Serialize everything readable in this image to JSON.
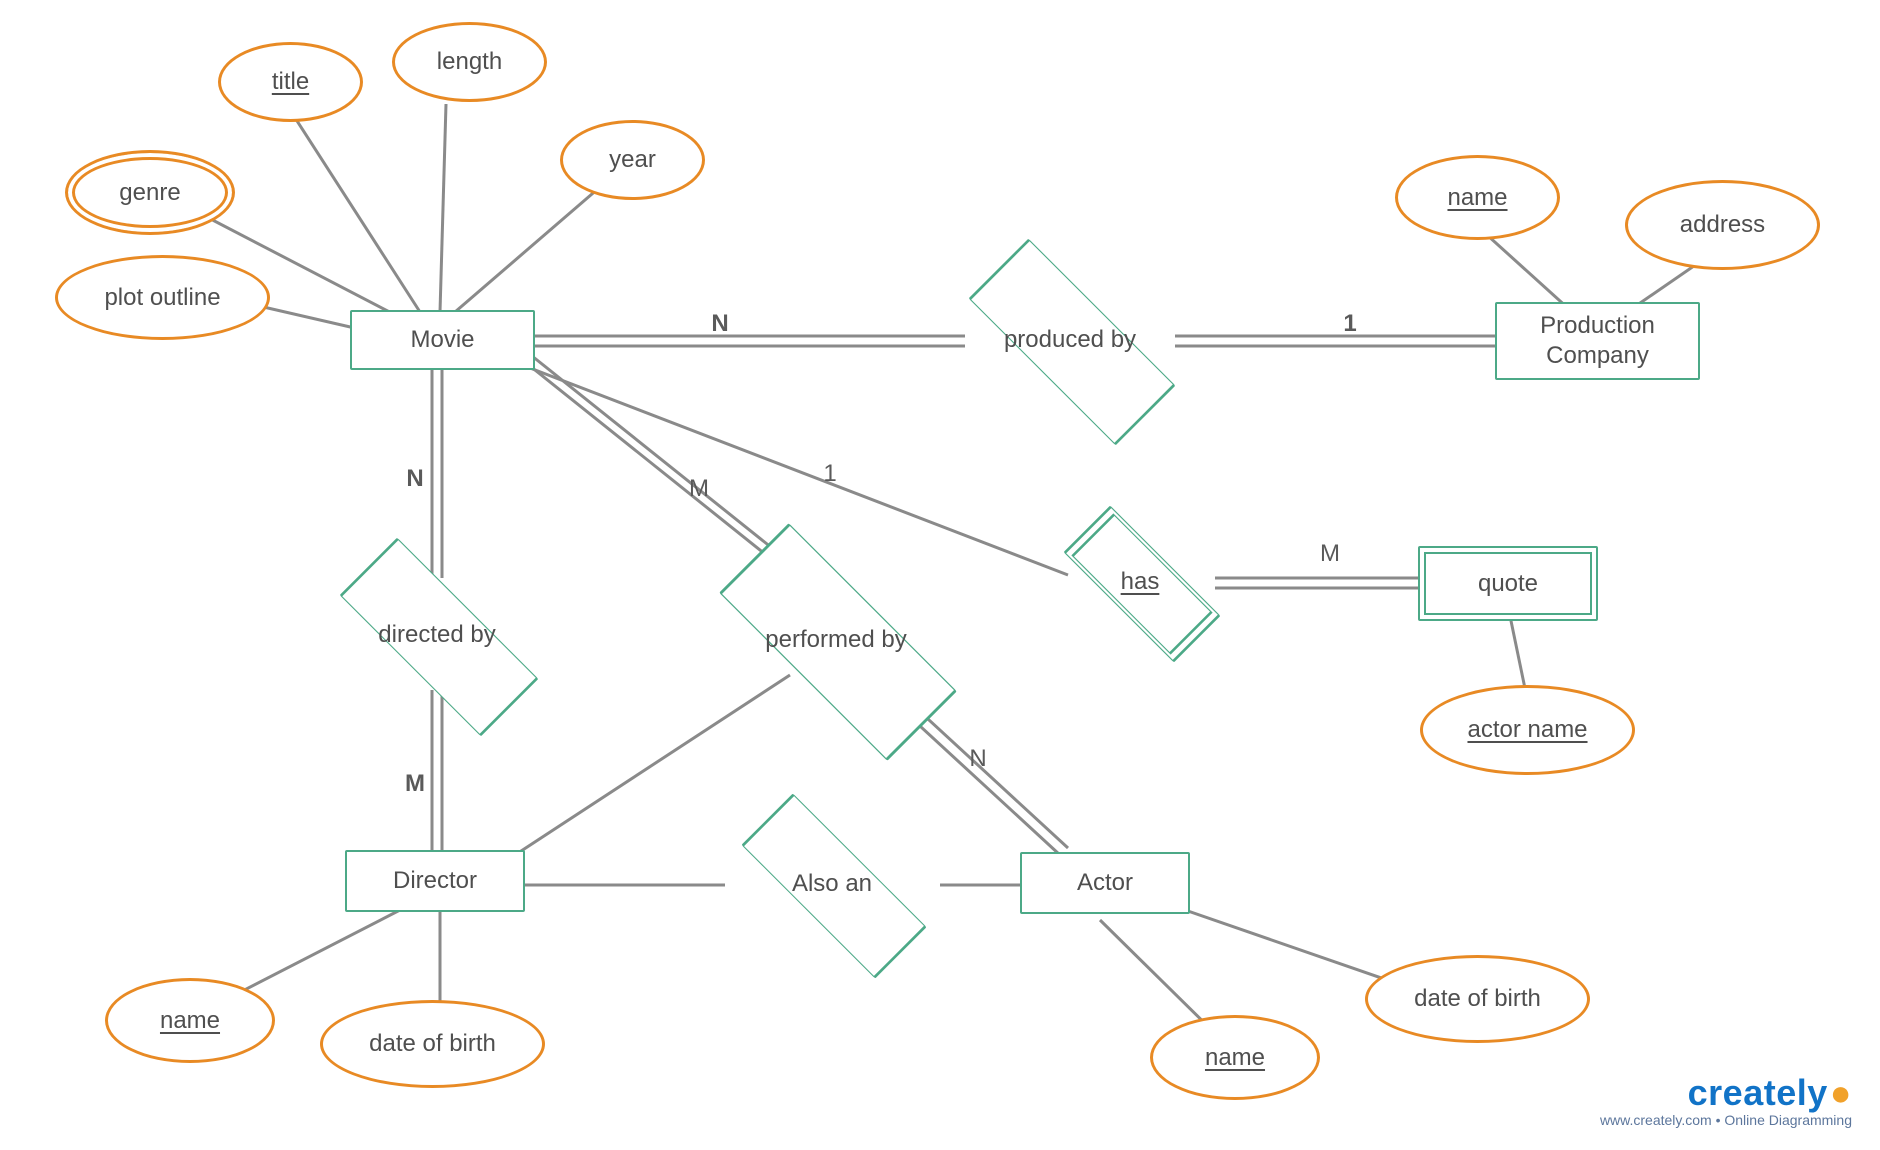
{
  "entities": {
    "movie": "Movie",
    "production_company": "Production\nCompany",
    "director": "Director",
    "actor": "Actor",
    "quote": "quote"
  },
  "relationships": {
    "produced_by": "produced by",
    "directed_by": "directed by",
    "performed_by": "performed by",
    "has": "has",
    "also_an": "Also an"
  },
  "attributes": {
    "genre": "genre",
    "title": "title",
    "length": "length",
    "year": "year",
    "plot_outline": "plot outline",
    "pc_name": "name",
    "pc_address": "address",
    "director_name": "name",
    "director_dob": "date of birth",
    "actor_name_attr": "name",
    "actor_dob": "date of birth",
    "quote_actor_name": "actor name"
  },
  "cardinalities": {
    "movie_produced": "N",
    "pc_produced": "1",
    "movie_directed": "N",
    "director_directed": "M",
    "movie_performed": "M",
    "actor_performed": "N",
    "movie_has": "1",
    "quote_has": "M"
  },
  "watermark": {
    "brand": "creately",
    "sub": "www.creately.com • Online Diagramming"
  }
}
